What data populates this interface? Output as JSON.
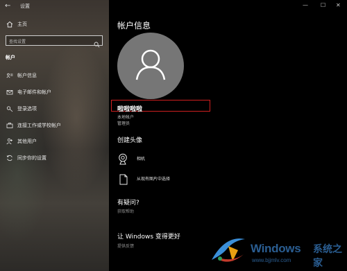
{
  "window": {
    "title": "设置",
    "back_glyph": "←",
    "minimize_glyph": "—",
    "maximize_glyph": "☐",
    "close_glyph": "✕"
  },
  "sidebar": {
    "home_label": "主页",
    "search_placeholder": "查找设置",
    "section_label": "帐户",
    "items": [
      {
        "label": "帐户信息",
        "icon": "person-card-icon"
      },
      {
        "label": "电子邮件和帐户",
        "icon": "mail-icon"
      },
      {
        "label": "登录选项",
        "icon": "key-icon"
      },
      {
        "label": "连接工作或学校帐户",
        "icon": "briefcase-icon"
      },
      {
        "label": "其他用户",
        "icon": "person-add-icon"
      },
      {
        "label": "同步你的设置",
        "icon": "sync-icon"
      }
    ]
  },
  "main": {
    "page_title": "帐户信息",
    "user_name": "啦啦啦啦",
    "account_type": "本地帐户",
    "role": "管理员",
    "create_avatar_heading": "创建头像",
    "camera_label": "相机",
    "browse_label": "从现有图片中选择",
    "questions_heading": "有疑问?",
    "get_help_link": "获取帮助",
    "improve_heading": "让 Windows 变得更好",
    "feedback_link": "提供反馈"
  },
  "watermark": {
    "brand": "Windows",
    "suffix": "系统之家",
    "url": "www.bjjmlv.com"
  },
  "colors": {
    "accent_red": "#d01f1f",
    "avatar_gray": "#767676",
    "watermark_blue": "#2a5d91"
  }
}
